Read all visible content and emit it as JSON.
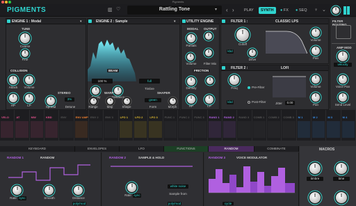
{
  "titlebar": {
    "title": "Pigments"
  },
  "topbar": {
    "logo": "PIGMENTS",
    "preset_name": "Rattling Tone",
    "play": "PLAY",
    "synth": "SYNTH",
    "fx": "FX",
    "seq": "SEQ"
  },
  "engine1": {
    "title": "ENGINE 1 : Modal",
    "tune": "TUNE",
    "coarse": "Coarse",
    "fine": "Fine",
    "collision": "COLLISION",
    "attack": "Attack",
    "volume": "Volume",
    "hp": "HP",
    "lp": "LP",
    "stereo": "STEREO",
    "spread": "Spread",
    "detune": "Detune",
    "stereo_val": "3%"
  },
  "engine2": {
    "title": "ENGINE 2 : Sample",
    "beam": "BEAM",
    "beam_val": "100 %",
    "decay": "Decay",
    "brilliance": "Brilliance",
    "timbre": "Timbre",
    "timbre_val": "full",
    "warp": "WARP",
    "shaper": "SHAPER",
    "range": "Range",
    "map": "Map",
    "shape": "Shape",
    "form": "Form",
    "morph": "Morph",
    "shaper_val": "green"
  },
  "utility": {
    "title": "UTILITY ENGINE",
    "modal": "MODAL",
    "output": "OUTPUT",
    "partials": "Partials",
    "volume": "Volume",
    "filter_mix": "Filter Mix",
    "friction": "FRICTION",
    "density": "Density",
    "hp": "HP",
    "lp": "LP"
  },
  "filter1": {
    "title": "FILTER 1 :",
    "type": "CLASSIC LPS",
    "cutoff": "Cutoff",
    "kbd": "kbd",
    "drive": "Drive",
    "volume": "Volume",
    "pan": "Pan"
  },
  "filter2": {
    "title": "FILTER 2 :",
    "type": "LOFI",
    "freq": "Freq",
    "pre_filter": "Pre-Filter",
    "post_filter": "Post-Filter",
    "jitter": "Jitter",
    "jitter_val": "0.00",
    "kbd": "kbd",
    "volume": "Volume",
    "pan": "Pan"
  },
  "filter_routing": {
    "title": "FILTER ROUTING",
    "amp_mod": "AMP MOD",
    "amp_mod_val": "velocity",
    "voice_pan": "Voice Pan",
    "send_level": "Send Level"
  },
  "mod_sources": [
    {
      "label": "VELO",
      "color": "#e0518c"
    },
    {
      "label": "AT",
      "color": "#e0518c"
    },
    {
      "label": "MW",
      "color": "#e0518c"
    },
    {
      "label": "KBD",
      "color": "#e0518c"
    },
    {
      "label": "ENV",
      "color": "#555"
    },
    {
      "label": "ENV AMP",
      "color": "#f08030"
    },
    {
      "label": "ENV 2",
      "color": "#555"
    },
    {
      "label": "ENV 3",
      "color": "#555"
    },
    {
      "label": "LFO 1",
      "color": "#e8c030"
    },
    {
      "label": "LFO 2",
      "color": "#e8c030"
    },
    {
      "label": "LFO 3",
      "color": "#e8c030"
    },
    {
      "label": "FUNC 1",
      "color": "#555"
    },
    {
      "label": "FUNC 2",
      "color": "#555"
    },
    {
      "label": "FUNC 3",
      "color": "#555"
    },
    {
      "label": "RAND 1",
      "color": "#b060e0"
    },
    {
      "label": "RAND 2",
      "color": "#b060e0"
    },
    {
      "label": "RAND 3",
      "color": "#555"
    },
    {
      "label": "COMB 1",
      "color": "#555"
    },
    {
      "label": "COMB 2",
      "color": "#555"
    },
    {
      "label": "COMB 3",
      "color": "#555"
    },
    {
      "label": "M 1",
      "color": "#3a8ee8"
    },
    {
      "label": "M 2",
      "color": "#3a8ee8"
    },
    {
      "label": "M 3",
      "color": "#3a8ee8"
    },
    {
      "label": "M 4",
      "color": "#3a8ee8"
    }
  ],
  "tabs": [
    "KEYBOARD",
    "ENVELOPES",
    "LFO",
    "FUNCTIONS",
    "RANDOM",
    "COMBINATE"
  ],
  "random1": {
    "title": "RANDOM 1",
    "mode": "RANDOM",
    "rate": "Rate",
    "rate_val": "sync",
    "smooth": "Smooth",
    "distance": "Distance",
    "dist_val": "poly/mod"
  },
  "random2": {
    "title": "RANDOM 2",
    "mode": "SAMPLE & HOLD",
    "rate": "Rate",
    "rate_val": "sync",
    "sample_from": "Sample from",
    "sample_val": "white noise",
    "bottom_val": "poly/mod"
  },
  "random3": {
    "title": "RANDOM 3",
    "mode": "VOICE MODULATOR",
    "bottom_val": "cycle"
  },
  "macros": {
    "title": "MACROS",
    "m1": "timbre",
    "m2": "time"
  },
  "colors": {
    "accent": "#2fd4cf",
    "purple": "#b060e0",
    "panel": "#2e2e31"
  }
}
